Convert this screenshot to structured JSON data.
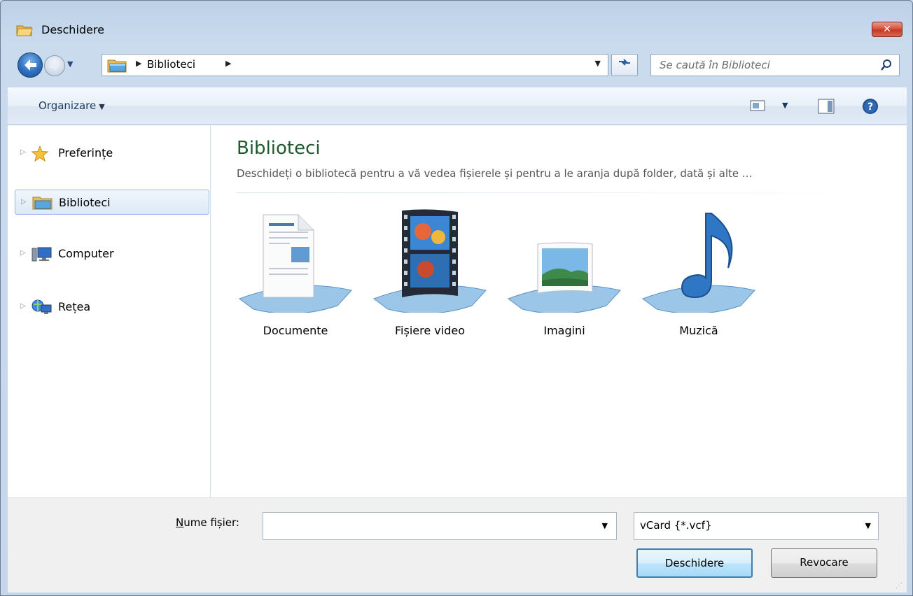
{
  "window": {
    "title": "Deschidere",
    "close_glyph": "✕"
  },
  "nav": {
    "breadcrumb": "Biblioteci",
    "search_placeholder": "Se caută în Biblioteci"
  },
  "toolbar": {
    "organize_label": "Organizare"
  },
  "sidebar": {
    "items": [
      {
        "label": "Preferințe",
        "icon": "star-icon"
      },
      {
        "label": "Biblioteci",
        "icon": "libraries-icon",
        "selected": true
      },
      {
        "label": "Computer",
        "icon": "computer-icon"
      },
      {
        "label": "Rețea",
        "icon": "network-icon"
      }
    ]
  },
  "main": {
    "title": "Biblioteci",
    "description": "Deschideți o bibliotecă pentru a vă vedea fișierele și pentru a le aranja după folder, dată și alte ...",
    "libraries": [
      {
        "name": "Documente",
        "icon": "documents-library-icon"
      },
      {
        "name": "Fișiere video",
        "icon": "videos-library-icon"
      },
      {
        "name": "Imagini",
        "icon": "pictures-library-icon"
      },
      {
        "name": "Muzică",
        "icon": "music-library-icon"
      }
    ]
  },
  "footer": {
    "filename_label_u": "N",
    "filename_label_rest": "ume fișier:",
    "filename_value": "",
    "filetype_value": "vCard {*.vcf}",
    "open_label": "Deschidere",
    "cancel_label": "Revocare"
  },
  "colors": {
    "title_green": "#1e5a2d",
    "accent_blue": "#3c7fb1",
    "close_red": "#c23a24"
  }
}
